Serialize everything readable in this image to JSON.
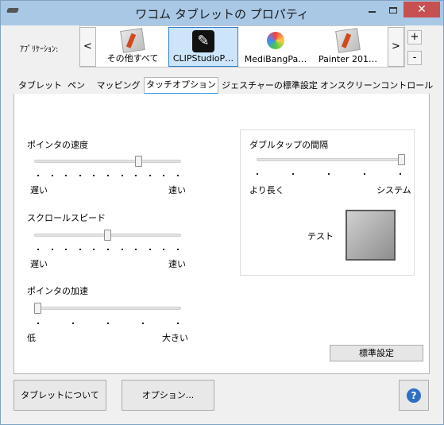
{
  "window": {
    "title": "ワコム タブレットの プロパティ"
  },
  "titlebar": {
    "close_glyph": "✕"
  },
  "apps": {
    "label": "ｱﾌﾟﾘｹｰｼｮﾝ:",
    "left_arrow": "<",
    "right_arrow": ">",
    "items": [
      {
        "label": "その他すべて",
        "icon": "app-generic-icon"
      },
      {
        "label": "CLIPStudioP…",
        "icon": "clip-studio-icon",
        "selected": true
      },
      {
        "label": "MediBangPa…",
        "icon": "medibang-icon"
      },
      {
        "label": "Painter 201…",
        "icon": "painter-icon"
      }
    ],
    "add": "+",
    "remove": "-"
  },
  "tabs": [
    {
      "label": "タブレット"
    },
    {
      "label": "ペン"
    },
    {
      "label": "マッピング"
    },
    {
      "label": "タッチオプション",
      "active": true
    },
    {
      "label": "ジェスチャーの標準設定"
    },
    {
      "label": "オンスクリーンコントロール"
    }
  ],
  "touch": {
    "pointer_speed": {
      "label": "ポインタの速度",
      "min": "遅い",
      "max": "速い",
      "level": 0.72
    },
    "scroll_speed": {
      "label": "スクロールスピード",
      "min": "遅い",
      "max": "速い",
      "level": 0.5
    },
    "pointer_accel": {
      "label": "ポインタの加速",
      "min": "低",
      "max": "大きい",
      "level": 0.0
    },
    "double_tap": {
      "label": "ダブルタップの間隔",
      "min": "より長く",
      "max": "システム",
      "level": 1.0
    },
    "test_label": "テスト",
    "default_button": "標準設定"
  },
  "footer": {
    "about_button": "タブレットについて",
    "options_button": "オプション...",
    "help_glyph": "?"
  },
  "colors": {
    "accent": "#3a9ee8",
    "close": "#c75050",
    "titlebar": "#a8c8e6"
  }
}
